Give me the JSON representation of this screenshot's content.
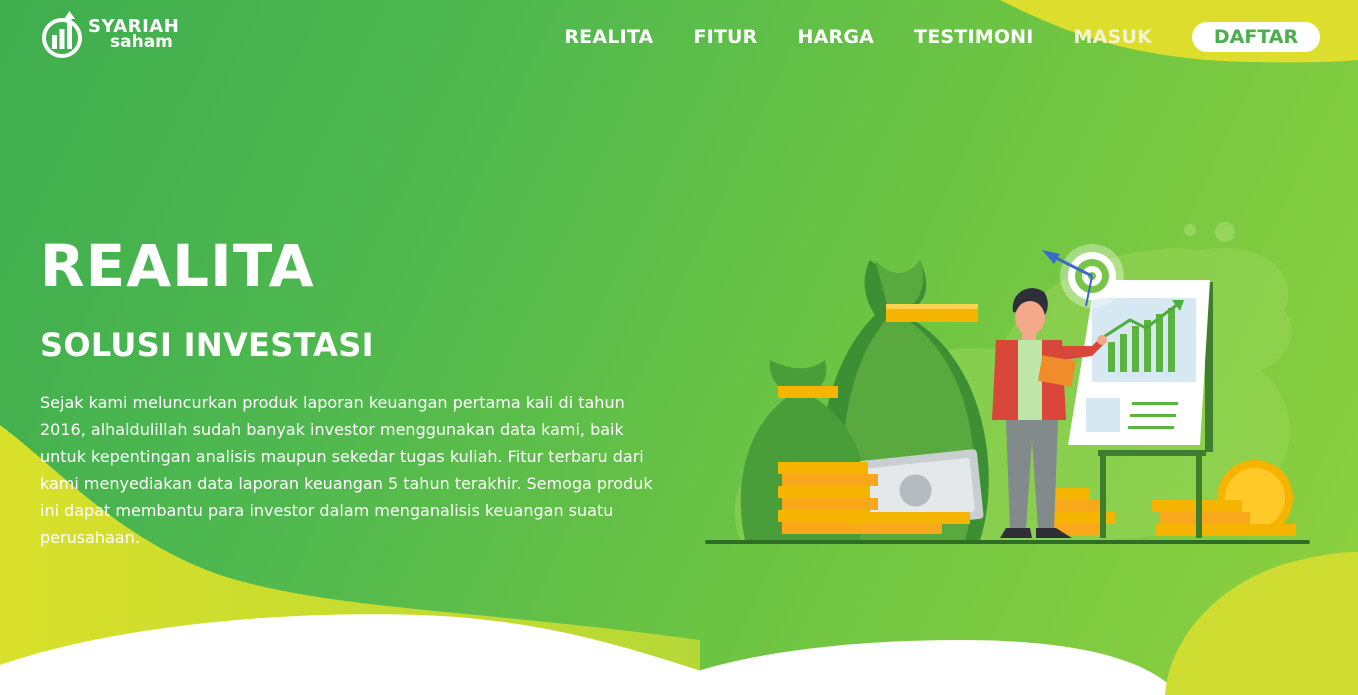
{
  "brand": {
    "name_line1": "SYARIAH",
    "name_line2": "saham"
  },
  "nav": {
    "items": [
      "REALITA",
      "FITUR",
      "HARGA",
      "TESTIMONI",
      "MASUK"
    ],
    "cta_label": "DAFTAR"
  },
  "hero": {
    "title": "REALITA",
    "subtitle": "SOLUSI INVESTASI",
    "description": "Sejak kami meluncurkan produk laporan keuangan pertama kali di tahun 2016, alhaldulillah sudah banyak investor menggunakan data kami, baik untuk kepentingan analisis maupun sekedar tugas kuliah. Fitur terbaru dari kami menyediakan data laporan keuangan 5 tahun terakhir. Semoga produk ini dapat membantu para investor dalam menganalisis keuangan suatu perusahaan."
  },
  "colors": {
    "green_dark": "#3fae4f",
    "green_light": "#8fd13e",
    "yellow_wave": "#e6dd2a",
    "coin_gold": "#f5b400",
    "shirt_red": "#d9473b",
    "cta_text": "#4cae4c"
  },
  "icons": {
    "logo": "bar-chart-arrow-logo-icon",
    "illustration": "investor-growth-illustration"
  }
}
